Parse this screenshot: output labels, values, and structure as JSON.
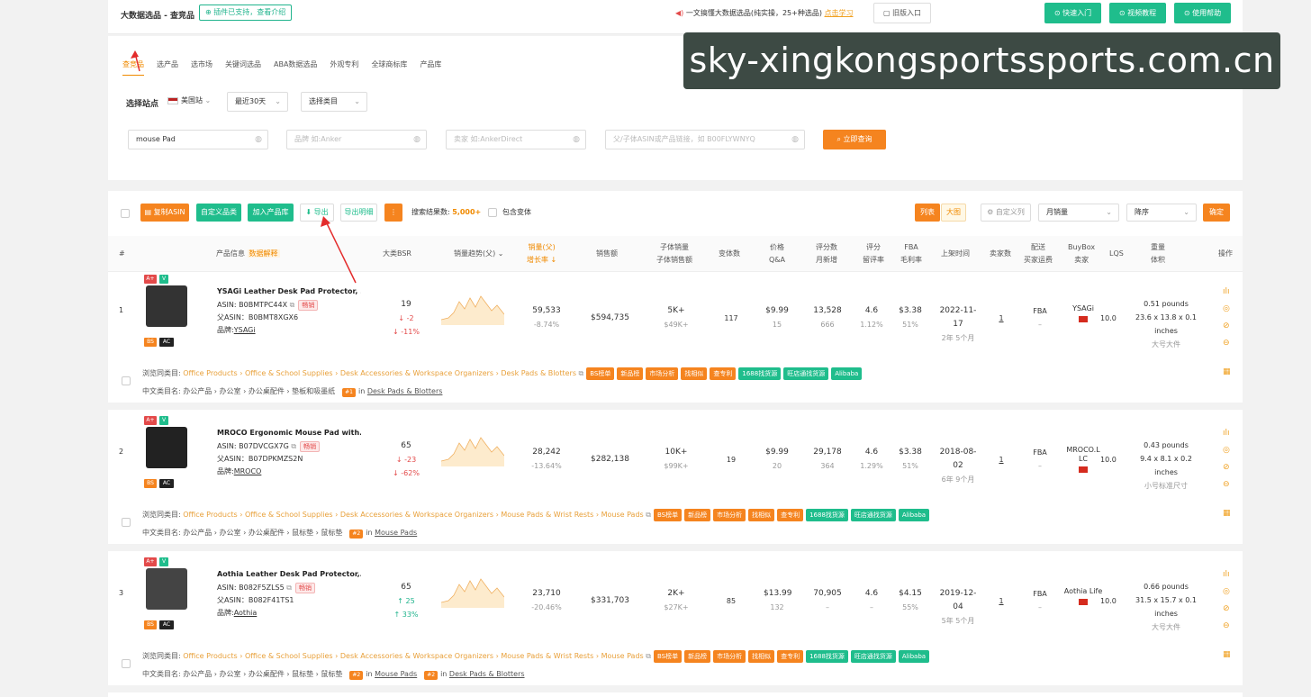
{
  "header": {
    "title": "大数据选品 - 查竞品",
    "plugin_badge": "⊕ 插件已支持，查看介绍",
    "notice": "一文搞懂大数据选品(纯实操，25+种选品)",
    "notice_link": "点击学习",
    "old_entry": "旧版入口",
    "quick_start": "快速入门",
    "video_tutorial": "视频教程",
    "help": "使用帮助"
  },
  "tabs": [
    "查竞品",
    "选产品",
    "选市场",
    "关键词选品",
    "ABA数据选品",
    "外观专利",
    "全球商标库",
    "产品库"
  ],
  "filters": {
    "site_label": "选择站点",
    "site": "美国站",
    "period": "最近30天",
    "category": "选择类目",
    "keyword_value": "mouse Pad",
    "brand_placeholder": "品牌 如:Anker",
    "seller_placeholder": "卖家 如:AnkerDirect",
    "asin_placeholder": "父/子体ASIN或产品链接，如 B00FLYWNYQ",
    "query_button": "立即查询"
  },
  "toolbar": {
    "copy_asin": "复制ASIN",
    "custom_category": "自定义品类",
    "add_library": "加入产品库",
    "export": "导出",
    "export_detail": "导出明细",
    "more": "⋮",
    "result_label": "搜索结果数:",
    "result_count": "5,000+",
    "include_variants": "包含变体",
    "view_list": "列表",
    "view_grid": "大图",
    "custom_columns": "自定义列",
    "sort_field": "月销量",
    "sort_order": "降序",
    "confirm": "确定"
  },
  "columns": {
    "index": "#",
    "product": "产品信息",
    "product_sub": "数据解释",
    "bsr": "大类BSR",
    "trend": "销量趋势(父)",
    "sales": "销量(父)",
    "sales_growth": "增长率",
    "revenue": "销售额",
    "child_sales": "子体销量",
    "child_revenue": "子体销售额",
    "variants": "变体数",
    "price": "价格",
    "qa": "Q&A",
    "reviews": "评分数",
    "reviews_new": "月新增",
    "rating": "评分",
    "rating_rate": "留评率",
    "fba": "FBA",
    "margin": "毛利率",
    "launch": "上架时间",
    "sellers": "卖家数",
    "fulfillment": "配送",
    "fulfillment_sub": "买家运费",
    "buybox": "BuyBox",
    "buybox_sub": "卖家",
    "lqs": "LQS",
    "weight": "重量",
    "volume": "体积",
    "ops": "操作"
  },
  "rows": [
    {
      "index": "1",
      "name": "YSAGi Leather Desk Pad Protector, ...",
      "asin": "ASIN: B0BMTPC44X",
      "parent_asin": "父ASIN：B0BMT8XGX6",
      "brand_label": "品牌:",
      "brand": "YSAGi",
      "tag": "畅销",
      "bsr": "19",
      "bsr_change": "↓ -2",
      "bsr_pct": "↓ -11%",
      "sales": "59,533",
      "sales_growth": "-8.74%",
      "revenue": "$594,735",
      "child_sales": "5K+",
      "child_revenue": "$49K+",
      "variants": "117",
      "price": "$9.99",
      "qa": "15",
      "reviews": "13,528",
      "reviews_new": "666",
      "rating": "4.6",
      "rating_rate": "1.12%",
      "fba": "$3.38",
      "margin": "51%",
      "launch": "2022-11-17",
      "age": "2年 5个月",
      "sellers": "1",
      "fulfillment": "FBA",
      "fulfillment_sub": "–",
      "buybox": "YSAGi",
      "lqs": "10.0",
      "weight": "0.51 pounds",
      "dims": "23.6 x 13.8 x 0.1 inches",
      "size": "大号大件",
      "category_label": "浏览同类目:",
      "category_path": "Office Products › Office & School Supplies › Desk Accessories & Workspace Organizers › Desk Pads & Blotters",
      "cn_label": "中文类目名:",
      "cn_path": "办公产品 › 办公室 › 办公桌配件 › 垫板和吸墨纸",
      "ranks": [
        {
          "rank": "#1",
          "in": "in",
          "name": "Desk Pads & Blotters"
        }
      ]
    },
    {
      "index": "2",
      "name": "MROCO Ergonomic Mouse Pad with...",
      "asin": "ASIN: B07DVCGX7G",
      "parent_asin": "父ASIN：B07DPKMZS2N",
      "brand_label": "品牌:",
      "brand": "MROCO",
      "tag": "畅销",
      "bsr": "65",
      "bsr_change": "↓ -23",
      "bsr_pct": "↓ -62%",
      "sales": "28,242",
      "sales_growth": "-13.64%",
      "revenue": "$282,138",
      "child_sales": "10K+",
      "child_revenue": "$99K+",
      "variants": "19",
      "price": "$9.99",
      "qa": "20",
      "reviews": "29,178",
      "reviews_new": "364",
      "rating": "4.6",
      "rating_rate": "1.29%",
      "fba": "$3.38",
      "margin": "51%",
      "launch": "2018-08-02",
      "age": "6年 9个月",
      "sellers": "1",
      "fulfillment": "FBA",
      "fulfillment_sub": "–",
      "buybox": "MROCO.L LC",
      "lqs": "10.0",
      "weight": "0.43 pounds",
      "dims": "9.4 x 8.1 x 0.2 inches",
      "size": "小号标准尺寸",
      "category_label": "浏览同类目:",
      "category_path": "Office Products › Office & School Supplies › Desk Accessories & Workspace Organizers › Mouse Pads & Wrist Rests › Mouse Pads",
      "cn_label": "中文类目名:",
      "cn_path": "办公产品 › 办公室 › 办公桌配件 › 鼠标垫 › 鼠标垫",
      "ranks": [
        {
          "rank": "#2",
          "in": "in",
          "name": "Mouse Pads"
        }
      ]
    },
    {
      "index": "3",
      "name": "Aothia Leather Desk Pad Protector,...",
      "asin": "ASIN: B082F5ZLS5",
      "parent_asin": "父ASIN：B082F41TS1",
      "brand_label": "品牌:",
      "brand": "Aothia",
      "tag": "畅销",
      "bsr": "65",
      "bsr_change": "↑ 25",
      "bsr_pct": "↑ 33%",
      "sales": "23,710",
      "sales_growth": "-20.46%",
      "revenue": "$331,703",
      "child_sales": "2K+",
      "child_revenue": "$27K+",
      "variants": "85",
      "price": "$13.99",
      "qa": "132",
      "reviews": "70,905",
      "reviews_new": "–",
      "rating": "4.6",
      "rating_rate": "–",
      "fba": "$4.15",
      "margin": "55%",
      "launch": "2019-12-04",
      "age": "5年 5个月",
      "sellers": "1",
      "fulfillment": "FBA",
      "fulfillment_sub": "–",
      "buybox": "Aothia Life",
      "lqs": "10.0",
      "weight": "0.66 pounds",
      "dims": "31.5 x 15.7 x 0.1 inches",
      "size": "大号大件",
      "category_label": "浏览同类目:",
      "category_path": "Office Products › Office & School Supplies › Desk Accessories & Workspace Organizers › Mouse Pads & Wrist Rests › Mouse Pads",
      "cn_label": "中文类目名:",
      "cn_path": "办公产品 › 办公室 › 办公桌配件 › 鼠标垫 › 鼠标垫",
      "ranks": [
        {
          "rank": "#2",
          "in": "in",
          "name": "Mouse Pads"
        },
        {
          "rank": "#2",
          "in": "in",
          "name": "Desk Pads & Blotters"
        }
      ]
    }
  ],
  "chips": [
    "BS榜单",
    "新品榜",
    "市场分析",
    "找相似",
    "查专利",
    "1688找货源",
    "旺店通找货源",
    "Alibaba"
  ],
  "watermark": "sky-xingkongsportssports.com.cn",
  "colors": {
    "accent": "#f5841f",
    "green": "#1fbd8c",
    "red": "#e34a4a"
  }
}
